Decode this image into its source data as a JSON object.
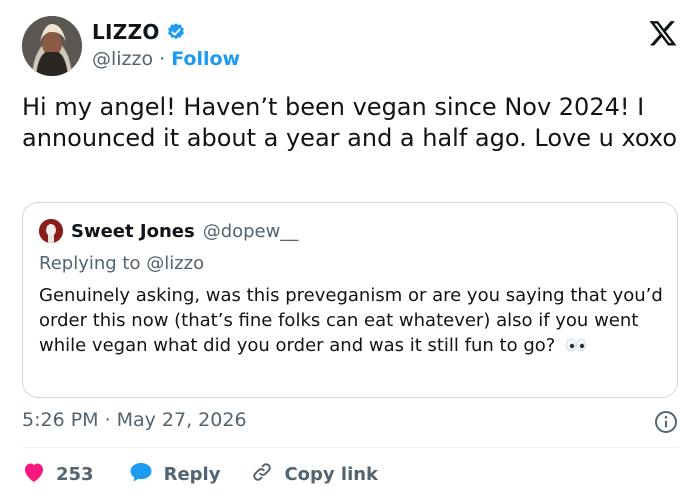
{
  "author": {
    "display_name": "LIZZO",
    "handle": "@lizzo",
    "separator": "·",
    "follow_label": "Follow"
  },
  "tweet": {
    "text": "Hi my angel! Haven’t been vegan since Nov 2024! I announced it about a year and a half ago. Love u xoxo",
    "time": "5:26 PM",
    "date_separator": "·",
    "date": "May 27, 2026"
  },
  "quote": {
    "display_name": "Sweet Jones",
    "handle": "@dopew__",
    "replying_to": "Replying to @lizzo",
    "text": "Genuinely asking, was this preveganism or are you saying that you’d order this now (that’s fine folks can eat whatever) also if you went while vegan what did you order and was it still fun to go?"
  },
  "actions": {
    "like_count": "253",
    "reply_label": "Reply",
    "copy_label": "Copy link"
  },
  "colors": {
    "accent": "#1d9bf0",
    "like": "#f91880",
    "text": "#0f1419",
    "muted": "#536471",
    "border": "#cfd9de"
  },
  "icons": [
    "verified-badge-icon",
    "x-logo-icon",
    "eyes-emoji-icon",
    "info-icon",
    "heart-icon",
    "reply-bubble-icon",
    "link-icon"
  ]
}
